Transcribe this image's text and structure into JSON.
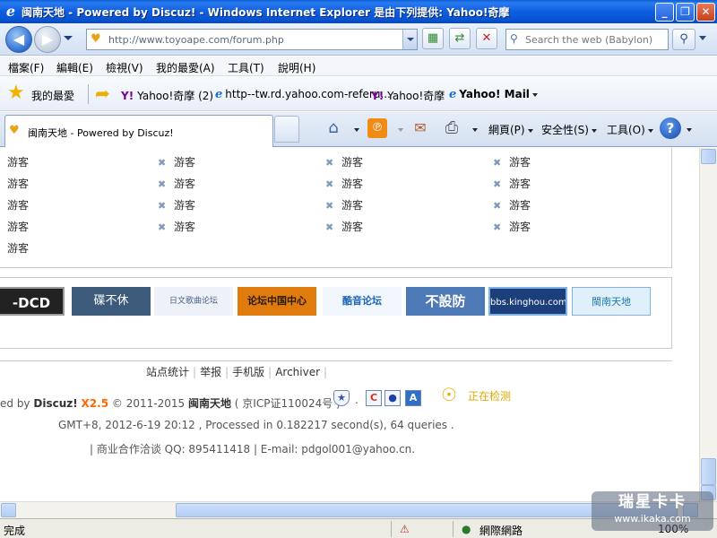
{
  "window": {
    "title": "闽南天地 - Powered by Discuz! - Windows Internet Explorer 是由下列提供: Yahoo!奇摩",
    "minimize": "_",
    "maximize": "❐",
    "close": "✕"
  },
  "address": {
    "url": "http://www.toyoape.com/forum.php",
    "search_placeholder": "Search the web (Babylon)"
  },
  "menu": [
    "檔案(F)",
    "編輯(E)",
    "檢視(V)",
    "我的最愛(A)",
    "工具(T)",
    "說明(H)"
  ],
  "favorites": {
    "label": "我的最愛",
    "links": [
      "Yahoo!奇摩 (2)",
      "http--tw.rd.yahoo.com-referu...",
      "Yahoo!奇摩",
      "Yahoo! Mail"
    ]
  },
  "tab": {
    "title": "闽南天地 - Powered by Discuz!"
  },
  "commands": {
    "page": "網頁(P)",
    "safety": "安全性(S)",
    "tools": "工具(O)"
  },
  "page": {
    "guest_label": "游客",
    "link_logos": [
      "-DCD",
      "碟不休",
      "日文歌曲论坛",
      "论坛中国中心",
      "酷音论坛",
      "不設防",
      "bbs.kinghou.com",
      "閩南天地"
    ],
    "footer_nav": [
      "站点统计",
      "举报",
      "手机版",
      "Archiver"
    ],
    "powered_prefix": "ed by",
    "powered_product": "Discuz!",
    "powered_version": "X2.5",
    "copyright": "© 2011-2015",
    "site_name": "闽南天地",
    "icp": "( 京ICP证110024号 )",
    "detecting": "正在检测",
    "stats": "GMT+8, 2012-6-19 20:12 , Processed in 0.182217 second(s), 64 queries .",
    "contact": "| 商业合作洽谈 QQ: 895411418 | E-mail: pdgol001@yahoo.cn."
  },
  "status": {
    "done": "完成",
    "zone": "網際網路",
    "zoom": "100%"
  },
  "watermark": {
    "line1": "瑞星卡卡",
    "line2": "www.ikaka.com"
  }
}
